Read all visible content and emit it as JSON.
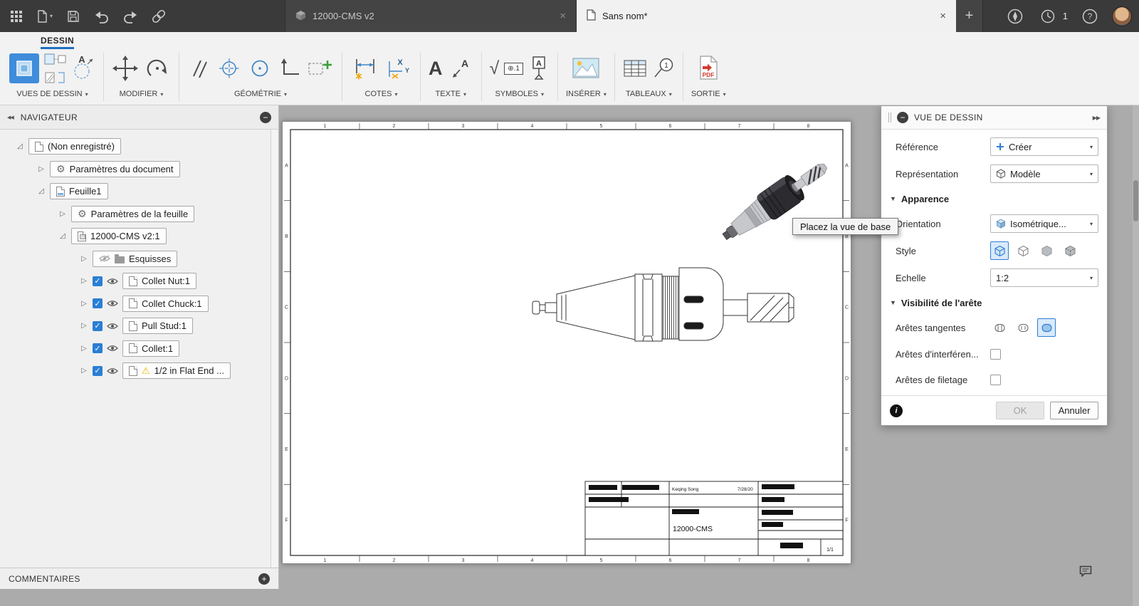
{
  "colors": {
    "accent_blue": "#3f8cdb",
    "checkbox_blue": "#2a7fd4",
    "topbar_bg": "#3a3a3a",
    "ribbon_bg": "#f2f2f2",
    "canvas_bg": "#ababab",
    "warning_yellow": "#f0b400",
    "pdf_red": "#d63b2f"
  },
  "icon_chars": {
    "plus": "+",
    "close": "×",
    "caret_down": "▾",
    "tri_down": "▼",
    "tri_closed": "▷",
    "tri_open": "◿",
    "minus": "−",
    "collapse_left": "◀◀",
    "expand_right": "▶▶",
    "check": "✓",
    "gear": "⚙",
    "warning": "⚠",
    "help": "?",
    "info": "i"
  },
  "topbar": {
    "tabs": [
      {
        "label": "12000-CMS v2"
      },
      {
        "label": "Sans nom*"
      }
    ],
    "notification_count": "1"
  },
  "ribbon": {
    "workspace_tab": "DESSIN",
    "groups": [
      {
        "label": "VUES DE DESSIN"
      },
      {
        "label": "MODIFIER"
      },
      {
        "label": "GÉOMÉTRIE"
      },
      {
        "label": "COTES"
      },
      {
        "label": "TEXTE"
      },
      {
        "label": "SYMBOLES"
      },
      {
        "label": "INSÉRER"
      },
      {
        "label": "TABLEAUX"
      },
      {
        "label": "SORTIE"
      }
    ],
    "icon_text": {
      "detail_letter": "A",
      "text_letter": "A",
      "leader_letter": "A",
      "surface_symbol": "√",
      "fcf_symbol": "⊕.1",
      "datum_letter": "A",
      "ord_x": "X",
      "ord_y": "Y",
      "balloon_number": "1",
      "pdf_label": "PDF"
    }
  },
  "navigator": {
    "title": "NAVIGATEUR",
    "comments_label": "COMMENTAIRES",
    "items": [
      {
        "label": "(Non enregistré)",
        "indent": 1,
        "expander": "open",
        "icon": "document"
      },
      {
        "label": "Paramètres du document",
        "indent": 2,
        "expander": "closed",
        "icon": "gear"
      },
      {
        "label": "Feuille1",
        "indent": 2,
        "expander": "open",
        "icon": "sheet"
      },
      {
        "label": "Paramètres de la feuille",
        "indent": 3,
        "expander": "closed",
        "icon": "gear"
      },
      {
        "label": "12000-CMS v2:1",
        "indent": 3,
        "expander": "open",
        "icon": "component"
      },
      {
        "label": "Esquisses",
        "indent": 4,
        "expander": "closed",
        "icon": "folder",
        "eye_off": true
      },
      {
        "label": "Collet Nut:1",
        "indent": 4,
        "expander": "closed",
        "icon": "part",
        "checkbox": true,
        "eye": true
      },
      {
        "label": "Collet Chuck:1",
        "indent": 4,
        "expander": "closed",
        "icon": "part",
        "checkbox": true,
        "eye": true
      },
      {
        "label": "Pull Stud:1",
        "indent": 4,
        "expander": "closed",
        "icon": "part",
        "checkbox": true,
        "eye": true
      },
      {
        "label": "Collet:1",
        "indent": 4,
        "expander": "closed",
        "icon": "part",
        "checkbox": true,
        "eye": true
      },
      {
        "label": "1/2 in Flat End ...",
        "indent": 4,
        "expander": "closed",
        "icon": "part",
        "checkbox": true,
        "eye": true,
        "warning": true
      }
    ]
  },
  "canvas": {
    "tooltip": "Placez la vue de base",
    "sheet": {
      "zones_h": [
        "1",
        "2",
        "3",
        "4",
        "5",
        "6",
        "7",
        "8"
      ],
      "zones_v": [
        "A",
        "B",
        "C",
        "D",
        "E",
        "F"
      ],
      "titleblock": {
        "author": "Keqing Song",
        "date": "7/28/20",
        "part_number": "12000-CMS",
        "sheet_of": "1/1"
      }
    }
  },
  "panel": {
    "title": "VUE DE DESSIN",
    "reference_label": "Référence",
    "reference_value": "Créer",
    "representation_label": "Représentation",
    "representation_value": "Modèle",
    "appearance_section": "Apparence",
    "orientation_label": "Orientation",
    "orientation_value": "Isométrique...",
    "style_label": "Style",
    "scale_label": "Echelle",
    "scale_value": "1:2",
    "edge_visibility_section": "Visibilité de l'arête",
    "tangent_edges_label": "Arêtes tangentes",
    "interference_edges_label": "Arêtes d'interféren...",
    "thread_edges_label": "Arêtes de filetage",
    "ok_label": "OK",
    "cancel_label": "Annuler"
  }
}
